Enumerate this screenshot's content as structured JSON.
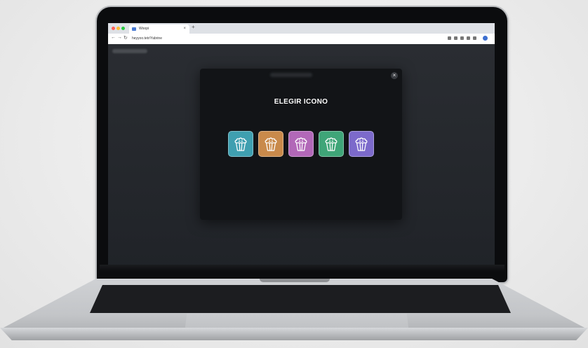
{
  "browser": {
    "tab_title": "Woopi",
    "tab_close": "×",
    "new_tab": "+",
    "url": "heyyoo.tetr/Yabrine",
    "back_icon": "arrow-left-icon",
    "forward_icon": "arrow-right-icon",
    "reload_icon": "reload-icon",
    "back_glyph": "←",
    "forward_glyph": "→",
    "reload_glyph": "↻",
    "traffic_lights": [
      "#ff5f57",
      "#febc2e",
      "#28c840"
    ]
  },
  "modal": {
    "title": "ELEGIR ICONO",
    "close_label": "×",
    "icons": [
      {
        "name": "popcorn-icon-blue",
        "color": "#3f9fb0"
      },
      {
        "name": "popcorn-icon-orange",
        "color": "#c98a4b"
      },
      {
        "name": "popcorn-icon-purple",
        "color": "#b268b8"
      },
      {
        "name": "popcorn-icon-green",
        "color": "#3fa578"
      },
      {
        "name": "popcorn-icon-violet",
        "color": "#7c6acb"
      }
    ]
  }
}
